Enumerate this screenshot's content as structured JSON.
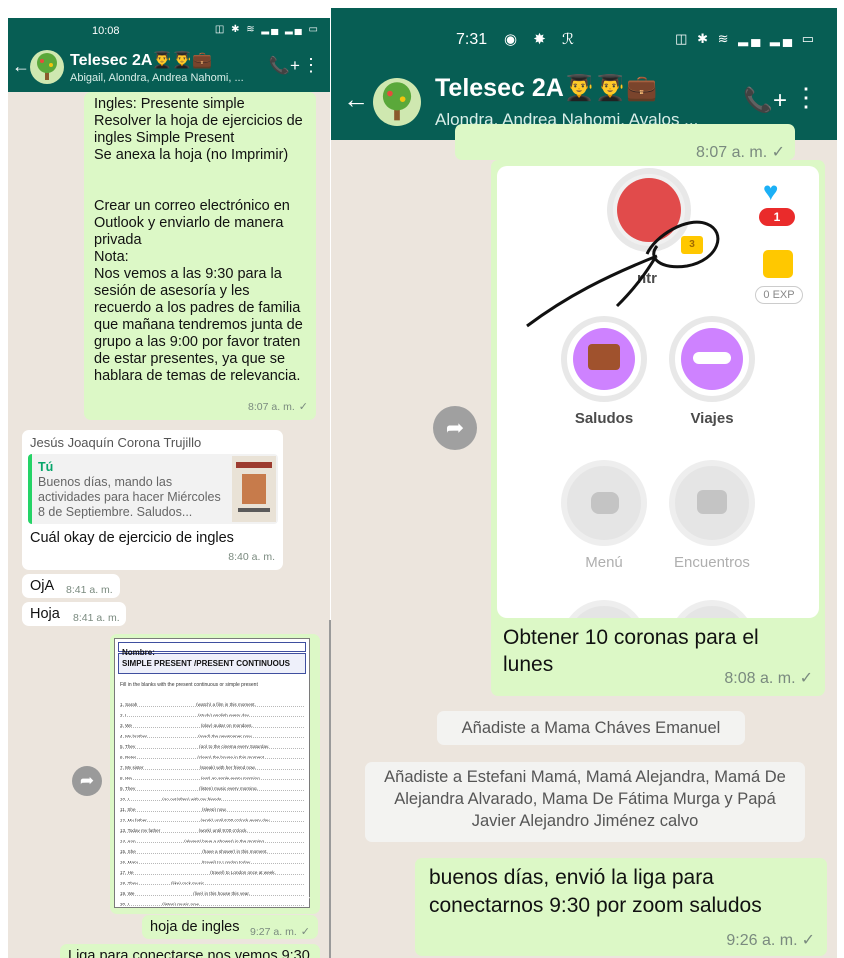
{
  "left": {
    "status": {
      "time": "10:08",
      "icons": "◫ ✱ ≋ ▂▄ ▂▄ ▭"
    },
    "header": {
      "title": "Telesec 2A👨‍🎓👨‍🎓💼",
      "subtitle": "Abigail, Alondra, Andrea Nahomi, ...",
      "back_icon": "←",
      "call_icon": "📞+",
      "menu_icon": "⋮"
    },
    "msg1": {
      "text": "Ingles: Presente simple\nResolver la hoja de ejercicios de ingles Simple Present\nSe anexa la hoja (no Imprimir)\n\n\nCrear un correo electrónico en Outlook y enviarlo de manera privada\nNota:\nNos vemos a las 9:30 para la sesión de asesoría y les recuerdo a los padres de familia que mañana tendremos junta de grupo a las 9:00 por favor traten de estar presentes, ya que se hablara de temas de relevancia.",
      "time": "8:07 a. m.",
      "check": "✓"
    },
    "msg2": {
      "sender": "Jesús Joaquín Corona Trujillo",
      "quote_author": "Tú",
      "quote_text": "Buenos días, mando las actividades para hacer Miércoles 8 de Septiembre. Saludos...",
      "text": "Cuál okay de ejercicio de ingles",
      "time": "8:40 a. m."
    },
    "msg3": {
      "text": "OjA",
      "time": "8:41 a. m."
    },
    "msg4": {
      "text": "Hoja",
      "time": "8:41 a. m."
    },
    "sheet": {
      "name_label": "Nombre:",
      "title": "SIMPLE PRESENT /PRESENT CONTINUOUS",
      "instructions": "Fill in the blanks with the present continuous or simple present",
      "lines": [
        "1.   Sarah ______________________ (watch) a film in this moment.",
        "2.   I ___________________________ (study) english every day.",
        "3.   We __________________________ (play)  guitar on mondays.",
        "4.   My brother ___________________ (read) the newspaper now.",
        "5.   They ________________________ (go) to the cinema every Saturday.",
        "6.   Peter _______________________ (clean) the house in this moment.",
        "7.   My sister _____________________ (speak) with her friend now.",
        "8.   We __________________________ (eat) an apple every morning.",
        "9.   They ________________________ (listen) music every morning.",
        "10.  I ____________ (go out/often) with my friends.",
        "11.  She _________________________ (sleep) now.",
        "12.  My father ____________________ (work) until 6:00 o'clock every day.",
        "13.  Today my father ______________ (work) until 9:00 o'clock.",
        "14.  Ann __________________ (always/ have a shower) in the morning.",
        "15.  She _________________________ (have a shower) in this moment.",
        "16.  Mary ________________________ (travel) to London today.",
        "17.  He _____________________________ (travel) to London once at week.",
        "18.  They ____________ (like) rock music.",
        "19.  We ______________________ (live) in this house this year.",
        "20.  I ____________ (listen) music now."
      ],
      "time": "9:27 a. m.",
      "check": "✓"
    },
    "msg5": {
      "text": "hoja de ingles",
      "time": "9:27 a. m.",
      "check": "✓"
    },
    "msg6": {
      "text": "Liga para conectarse nos vemos 9:30"
    },
    "forward_icon": "➦"
  },
  "right": {
    "status": {
      "time": "7:31",
      "app_icons": "◉ ✸ ℛ",
      "icons": "◫ ✱ ≋ ▂▄ ▂▄ ▭"
    },
    "header": {
      "title": "Telesec 2A👨‍🎓👨‍🎓💼",
      "subtitle": "Alondra, Andrea Nahomi, Avalos ...",
      "back_icon": "←",
      "call_icon": "📞+",
      "menu_icon": "⋮"
    },
    "prev_time": "8:07 a. m. ✓",
    "duo": {
      "crown_count": "3",
      "partial_label": "ntr",
      "hearts": "1",
      "exp": "0 EXP",
      "nodes": [
        "Saludos",
        "Viajes",
        "Menú",
        "Encuentros"
      ]
    },
    "msg1": {
      "text": "Obtener 10 coronas para el lunes",
      "time": "8:08 a. m.",
      "check": "✓"
    },
    "sys1": "Añadiste a Mama Cháves Emanuel",
    "sys2": "Añadiste a Estefani Mamá, Mamá Alejandra, Mamá De Alejandra Alvarado, Mama De Fátima Murga y Papá Javier Alejandro Jiménez calvo",
    "msg2": {
      "text": "buenos días, envió la liga para conectarnos 9:30 por zoom saludos",
      "time": "9:26 a. m.",
      "check": "✓"
    },
    "forward_icon": "➦"
  },
  "colors": {
    "header": "#075e54",
    "outgoing": "#dcf8c6",
    "incoming": "#ffffff",
    "background": "#ece5dd",
    "accent": "#25d366"
  }
}
